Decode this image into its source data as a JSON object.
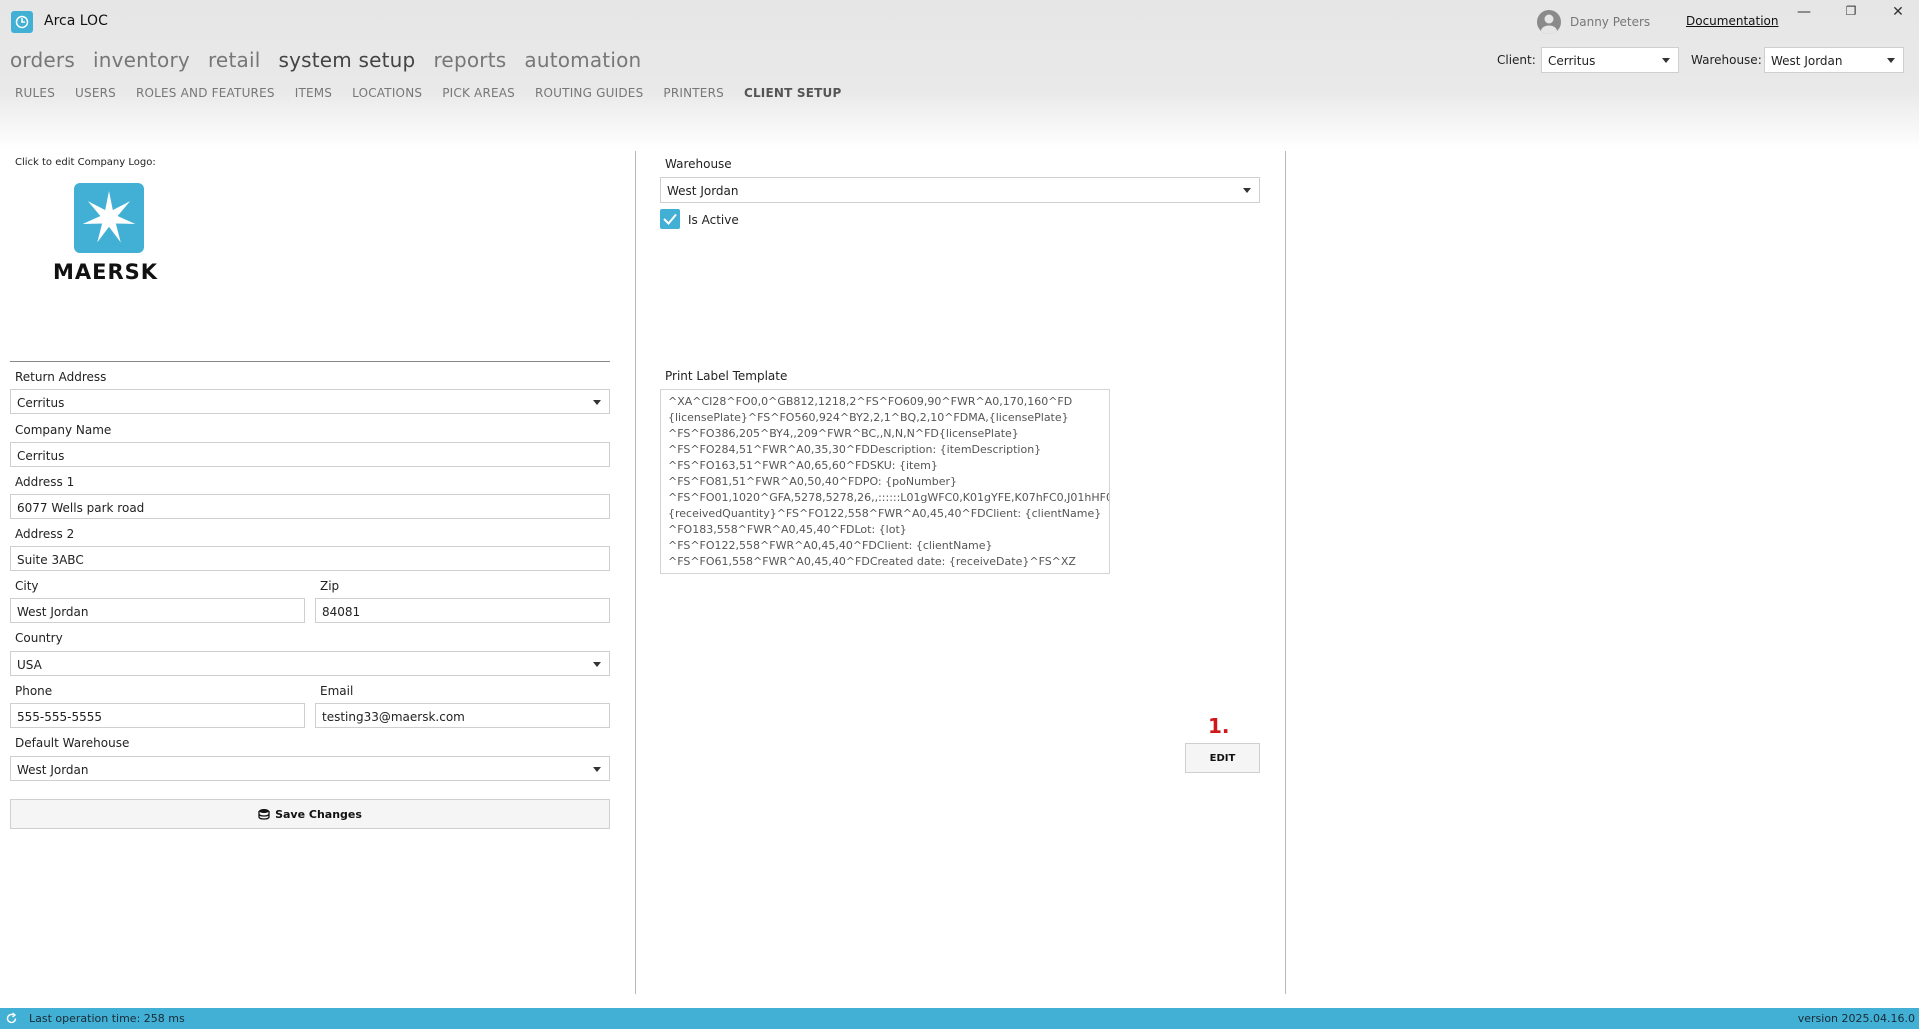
{
  "app": {
    "title": "Arca LOC"
  },
  "user": {
    "name": "Danny Peters",
    "documentation_label": "Documentation"
  },
  "window_controls": {
    "minimize": "—",
    "restore": "❐",
    "close": "✕"
  },
  "main_nav": {
    "items": [
      "orders",
      "inventory",
      "retail",
      "system setup",
      "reports",
      "automation"
    ],
    "active": "system setup"
  },
  "sub_nav": {
    "items": [
      "RULES",
      "USERS",
      "ROLES AND FEATURES",
      "ITEMS",
      "LOCATIONS",
      "PICK AREAS",
      "ROUTING GUIDES",
      "PRINTERS",
      "CLIENT SETUP"
    ],
    "active": "CLIENT SETUP"
  },
  "header": {
    "client_label": "Client:",
    "client_value": "Cerritus",
    "warehouse_label": "Warehouse:",
    "warehouse_value": "West Jordan"
  },
  "left_panel": {
    "logo_caption": "Click to edit Company Logo:",
    "logo_text": "MAERSK",
    "return_address_label": "Return Address",
    "return_address_value": "Cerritus",
    "company_name_label": "Company Name",
    "company_name_value": "Cerritus",
    "address1_label": "Address 1",
    "address1_value": "6077 Wells park road",
    "address2_label": "Address 2",
    "address2_value": "Suite 3ABC",
    "city_label": "City",
    "city_value": "West Jordan",
    "zip_label": "Zip",
    "zip_value": "84081",
    "country_label": "Country",
    "country_value": "USA",
    "phone_label": "Phone",
    "phone_value": "555-555-5555",
    "email_label": "Email",
    "email_value": "testing33@maersk.com",
    "default_warehouse_label": "Default Warehouse",
    "default_warehouse_value": "West Jordan",
    "save_label": "Save Changes"
  },
  "right_panel": {
    "warehouse_label": "Warehouse",
    "warehouse_value": "West Jordan",
    "is_active_label": "Is Active",
    "is_active_checked": true,
    "template_label": "Print Label Template",
    "template_lines": [
      "^XA^CI28^FO0,0^GB812,1218,2^FS^FO609,90^FWR^A0,170,160^FD",
      "{licensePlate}^FS^FO560,924^BY2,2,1^BQ,2,10^FDMA,{licensePlate}",
      "^FS^FO386,205^BY4,,209^FWR^BC,,N,N,N^FD{licensePlate}",
      "^FS^FO284,51^FWR^A0,35,30^FDDescription: {itemDescription}",
      "^FS^FO163,51^FWR^A0,65,60^FDSKU: {item}",
      "^FS^FO81,51^FWR^A0,50,40^FDPO: {poNumber}",
      "^FS^FO01,1020^GFA,5278,5278,26,,::::::L01gWFC0,K01gYFE,K07hFC0,J01hHF0,J03h",
      "{receivedQuantity}^FS^FO122,558^FWR^A0,45,40^FDClient: {clientName}",
      "^FO183,558^FWR^A0,45,40^FDLot: {lot}",
      "^FS^FO122,558^FWR^A0,45,40^FDClient: {clientName}",
      "^FS^FO61,558^FWR^A0,45,40^FDCreated date: {receiveDate}^FS^XZ"
    ],
    "annotation": "1.",
    "edit_label": "EDIT"
  },
  "status_bar": {
    "operation_text": "Last operation time:  258 ms",
    "version_text": "version 2025.04.16.0"
  },
  "colors": {
    "accent": "#42b0d5",
    "annotation": "#d01818"
  }
}
